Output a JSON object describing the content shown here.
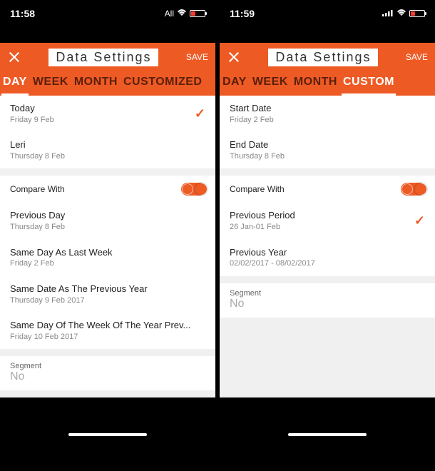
{
  "left": {
    "status": {
      "time": "11:58",
      "carrier": "All"
    },
    "header": {
      "title": "Data Settings",
      "save": "SAVE"
    },
    "tabs": [
      "DAY",
      "WEEK",
      "MONTH",
      "CUSTOMIZED"
    ],
    "active_tab": 0,
    "options": [
      {
        "title": "Today",
        "sub": "Friday 9 Feb",
        "selected": true
      },
      {
        "title": "Leri",
        "sub": "Thursday 8 Feb",
        "selected": false
      }
    ],
    "compare_label": "Compare With",
    "compare_on": true,
    "compare_options": [
      {
        "title": "Previous Day",
        "sub": "Thursday 8 Feb"
      },
      {
        "title": "Same Day As Last Week",
        "sub": "Friday 2 Feb"
      },
      {
        "title": "Same Date As The Previous Year",
        "sub": "Thursday 9 Feb 2017"
      },
      {
        "title": "Same Day Of The Week Of The Year Prev...",
        "sub": "Friday 10 Feb 2017"
      }
    ],
    "segment": {
      "label": "Segment",
      "value": "No"
    }
  },
  "right": {
    "status": {
      "time": "11:59"
    },
    "header": {
      "title": "Data Settings",
      "save": "SAVE"
    },
    "tabs": [
      "DAY",
      "WEEK",
      "MONTH",
      "CUSTOM"
    ],
    "active_tab": 3,
    "dates": [
      {
        "title": "Start Date",
        "sub": "Friday 2 Feb"
      },
      {
        "title": "End Date",
        "sub": "Thursday 8 Feb"
      }
    ],
    "compare_label": "Compare With",
    "compare_on": true,
    "compare_options": [
      {
        "title": "Previous Period",
        "sub": "26 Jan-01 Feb",
        "selected": true
      },
      {
        "title": "Previous Year",
        "sub": "02/02/2017 - 08/02/2017",
        "selected": false
      }
    ],
    "segment": {
      "label": "Segment",
      "value": "No"
    }
  }
}
